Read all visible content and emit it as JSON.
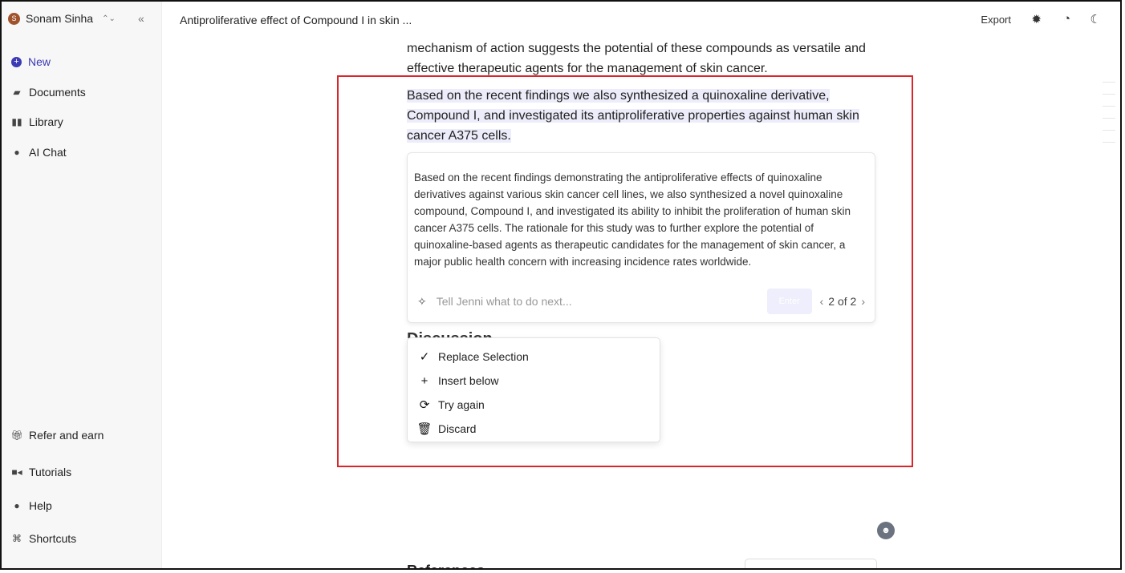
{
  "sidebar": {
    "user": {
      "initial": "S",
      "name": "Sonam Sinha"
    },
    "collapse_icon": "double-chevron-left-icon",
    "top_items": [
      {
        "label": "New",
        "icon": "plus-circle-icon"
      },
      {
        "label": "Documents",
        "icon": "documents-icon"
      },
      {
        "label": "Library",
        "icon": "library-icon"
      },
      {
        "label": "AI Chat",
        "icon": "chat-bubble-icon"
      }
    ],
    "bottom_items": [
      {
        "label": "Refer and earn",
        "icon": "gift-icon"
      },
      {
        "label": "Tutorials",
        "icon": "video-icon"
      },
      {
        "label": "Help",
        "icon": "info-icon"
      },
      {
        "label": "Shortcuts",
        "icon": "command-icon"
      }
    ]
  },
  "topbar": {
    "title": "Antiproliferative effect of Compound I in skin ...",
    "export_label": "Export"
  },
  "editor": {
    "previous_paragraph": "mechanism of action suggests the potential of these compounds as versatile and effective therapeutic agents for the management of skin cancer.",
    "selected_paragraph": "Based on the recent findings we also synthesized a quinoxaline derivative, Compound I, and investigated its antiproliferative properties against human skin cancer A375 cells.",
    "partial_heading": "Discussion",
    "references_heading": "References"
  },
  "suggestion": {
    "text": "Based on the recent findings demonstrating the antiproliferative effects of quinoxaline derivatives against various skin cancer cell lines, we also synthesized a novel quinoxaline compound, Compound I, and investigated its ability to inhibit the proliferation of human skin cancer A375 cells. The rationale for this study was to further explore the potential of quinoxaline-based agents as therapeutic candidates for the management of skin cancer, a major public health concern with increasing incidence rates worldwide.",
    "prompt_placeholder": "Tell Jenni what to do next...",
    "enter_label": "Enter",
    "pager": "2 of 2"
  },
  "action_menu": {
    "items": [
      {
        "label": "Replace Selection",
        "icon": "check-icon"
      },
      {
        "label": "Insert below",
        "icon": "plus-icon"
      },
      {
        "label": "Try again",
        "icon": "refresh-icon"
      },
      {
        "label": "Discard",
        "icon": "trash-icon"
      }
    ]
  },
  "colors": {
    "accent": "#3b3bb3",
    "selection_highlight": "#ececfa",
    "annotation_box": "#d9262b"
  }
}
